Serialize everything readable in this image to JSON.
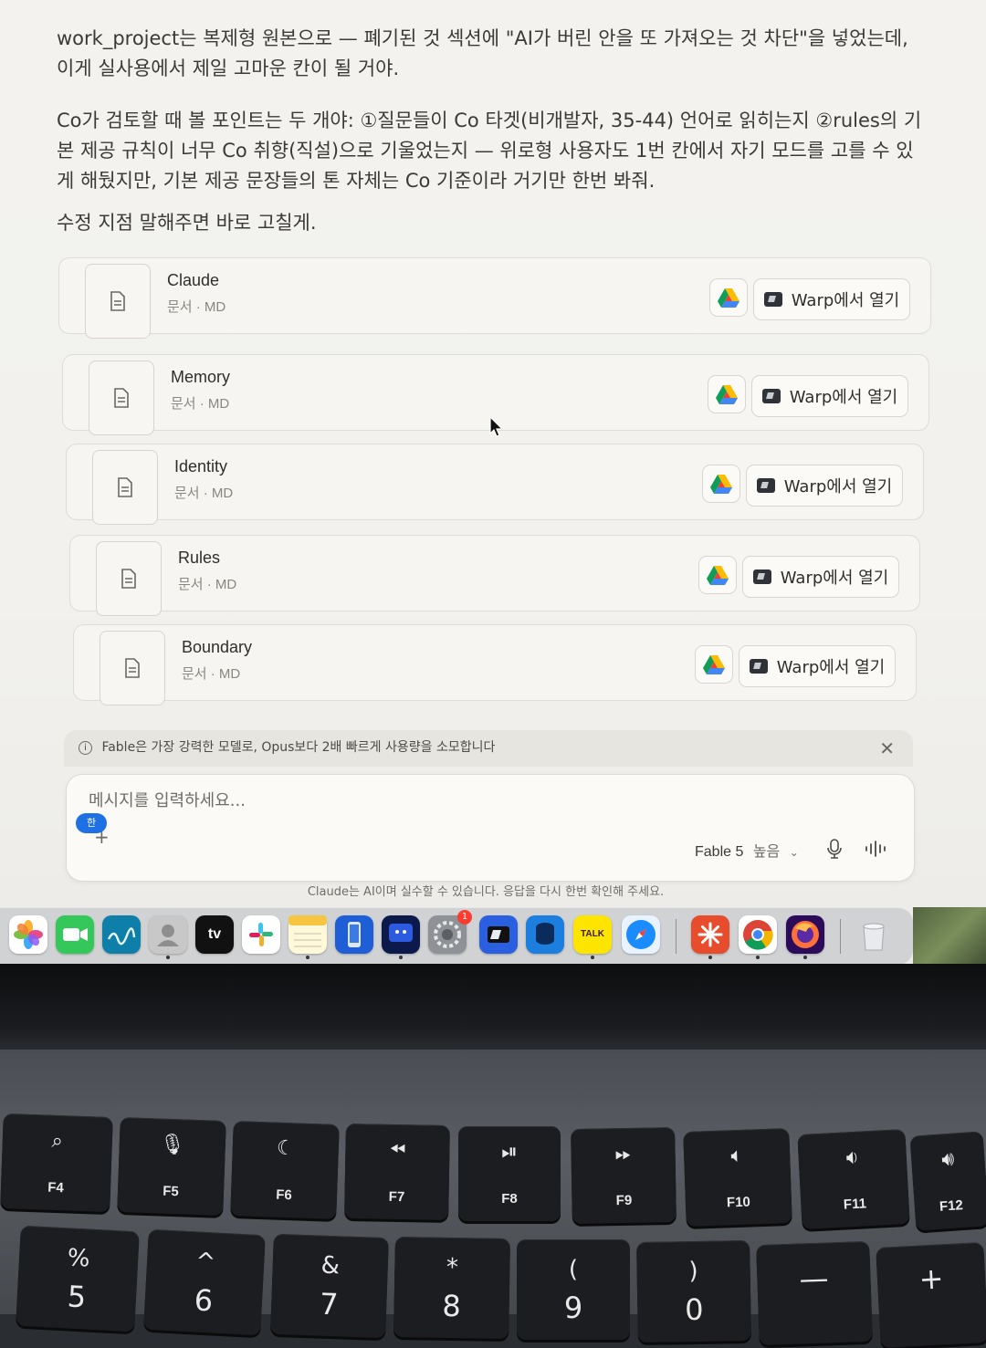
{
  "message": {
    "paragraph1": "work_project는 복제형 원본으로 — 폐기된 것 섹션에 \"AI가 버린 안을 또 가져오는 것 차단\"을 넣었는데, 이게 실사용에서 제일 고마운 칸이 될 거야.",
    "paragraph2": "Co가 검토할 때 볼 포인트는 두 개야: ①질문들이 Co 타겟(비개발자, 35-44) 언어로 읽히는지 ②rules의 기본 제공 규칙이 너무 Co 취향(직설)으로 기울었는지 — 위로형 사용자도 1번 칸에서 자기 모드를 고를 수 있게 해뒀지만, 기본 제공 문장들의 톤 자체는 Co 기준이라 거기만 한번 봐줘.",
    "paragraph3": "수정 지점 말해주면 바로 고칠게."
  },
  "attachments": [
    {
      "name": "Claude",
      "meta": "문서 · MD",
      "open_label": "Warp에서 열기"
    },
    {
      "name": "Memory",
      "meta": "문서 · MD",
      "open_label": "Warp에서 열기"
    },
    {
      "name": "Identity",
      "meta": "문서 · MD",
      "open_label": "Warp에서 열기"
    },
    {
      "name": "Rules",
      "meta": "문서 · MD",
      "open_label": "Warp에서 열기"
    },
    {
      "name": "Boundary",
      "meta": "문서 · MD",
      "open_label": "Warp에서 열기"
    }
  ],
  "notice": {
    "text": "Fable은 가장 강력한 모델로, Opus보다 2배 빠르게 사용량을 소모합니다"
  },
  "composer": {
    "placeholder": "메시지를 입력하세요...",
    "ime_indicator": "한",
    "model": "Fable 5",
    "effort": "높음"
  },
  "disclaimer": "Claude는 AI이며 실수할 수 있습니다. 응답을 다시 한번 확인해 주세요.",
  "dock": {
    "apps": [
      "photos",
      "facetime",
      "freeform",
      "contacts",
      "apple-tv",
      "slack",
      "notes",
      "simulator",
      "finder-like",
      "system-settings",
      "warp",
      "db-app",
      "kakaotalk",
      "safari",
      "claude",
      "chrome",
      "firefox",
      "trash"
    ],
    "settings_badge": "1",
    "tv_label": "tv",
    "kakao_label": "TALK"
  },
  "keyboard": {
    "function_keys": [
      {
        "label": "F4",
        "icon": "search-icon"
      },
      {
        "label": "F5",
        "icon": "mic-icon"
      },
      {
        "label": "F6",
        "icon": "moon-icon"
      },
      {
        "label": "F7",
        "icon": "rewind-icon"
      },
      {
        "label": "F8",
        "icon": "play-pause-icon"
      },
      {
        "label": "F9",
        "icon": "fast-forward-icon"
      },
      {
        "label": "F10",
        "icon": "mute-icon"
      },
      {
        "label": "F11",
        "icon": "volume-down-icon"
      },
      {
        "label": "F12",
        "icon": "volume-up-icon"
      }
    ],
    "number_keys": [
      {
        "top": "%",
        "bottom": "5"
      },
      {
        "top": "^",
        "bottom": "6"
      },
      {
        "top": "&",
        "bottom": "7"
      },
      {
        "top": "*",
        "bottom": "8"
      },
      {
        "top": "(",
        "bottom": "9"
      },
      {
        "top": ")",
        "bottom": "0"
      },
      {
        "top": "",
        "bottom": "—"
      },
      {
        "top": "",
        "bottom": "+"
      }
    ]
  }
}
